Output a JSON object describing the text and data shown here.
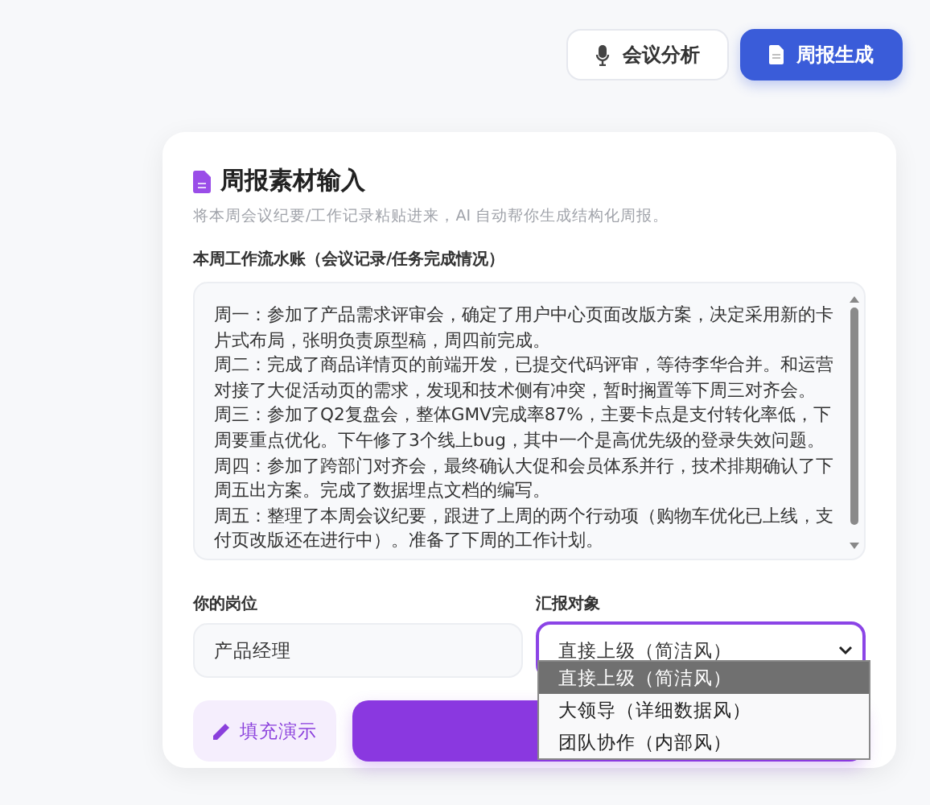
{
  "tabs": [
    {
      "label": "会议分析",
      "selected": false
    },
    {
      "label": "周报生成",
      "selected": true
    }
  ],
  "card": {
    "title": "周报素材输入",
    "subtitle": "将本周会议纪要/工作记录粘贴进来，AI 自动帮你生成结构化周报。",
    "log_label": "本周工作流水账（会议记录/任务完成情况）",
    "log_lines": [
      "周一：参加了产品需求评审会，确定了用户中心页面改版方案，决定采用新的卡",
      "片式布局，张明负责原型稿，周四前完成。",
      "周二：完成了商品详情页的前端开发，已提交代码评审，等待李华合并。和运营",
      "对接了大促活动页的需求，发现和技术侧有冲突，暂时搁置等下周三对齐会。",
      "周三：参加了Q2复盘会，整体GMV完成率87%，主要卡点是支付转化率低，下",
      "周要重点优化。下午修了3个线上bug，其中一个是高优先级的登录失效问题。",
      "周四：参加了跨部门对齐会，最终确认大促和会员体系并行，技术排期确认了下",
      "周五出方案。完成了数据埋点文档的编写。",
      "周五：整理了本周会议纪要，跟进了上周的两个行动项（购物车优化已上线，支",
      "付页改版还在进行中）。准备了下周的工作计划。"
    ],
    "role": {
      "label": "你的岗位",
      "value": "产品经理"
    },
    "audience": {
      "label": "汇报对象",
      "value": "直接上级（简洁风）",
      "expanded": true,
      "options": [
        {
          "label": "直接上级（简洁风）",
          "selected": true
        },
        {
          "label": "大领导（详细数据风）",
          "selected": false
        },
        {
          "label": "团队协作（内部风）",
          "selected": false
        }
      ]
    },
    "demo_button": "填充演示"
  }
}
